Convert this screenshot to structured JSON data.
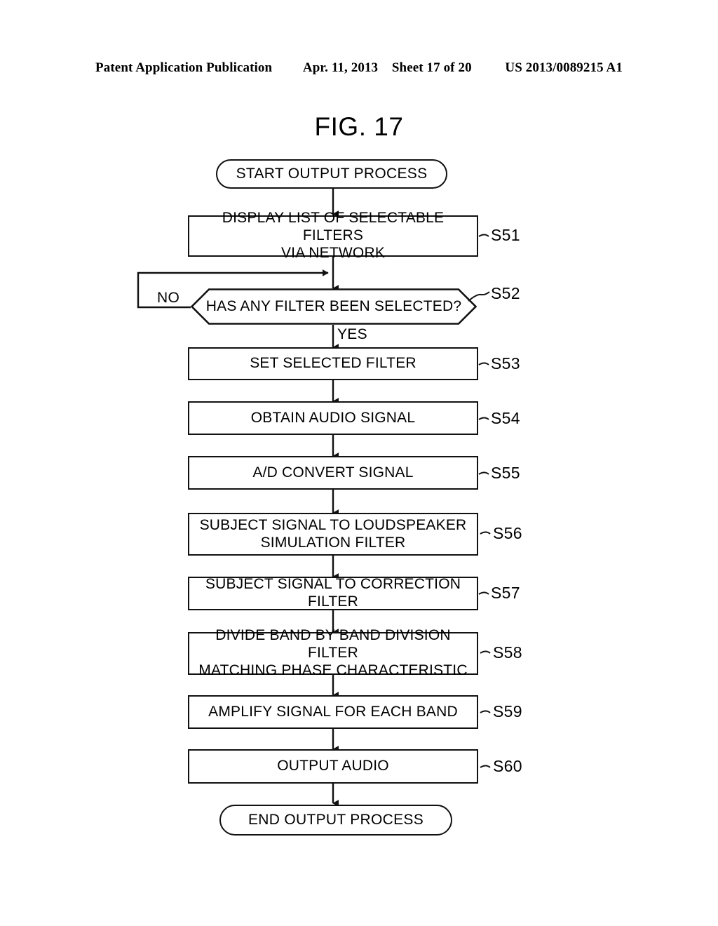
{
  "header": {
    "publication": "Patent Application Publication",
    "date": "Apr. 11, 2013",
    "sheet": "Sheet 17 of 20",
    "patent_number": "US 2013/0089215 A1"
  },
  "figure": {
    "title": "FIG. 17"
  },
  "flowchart": {
    "start": {
      "label": "START OUTPUT PROCESS",
      "shape": "terminator"
    },
    "end": {
      "label": "END OUTPUT PROCESS",
      "shape": "terminator"
    },
    "decision": {
      "label": "HAS ANY FILTER BEEN SELECTED?",
      "step": "S52",
      "shape": "hexagon",
      "yes_label": "YES",
      "no_label": "NO"
    },
    "steps": [
      {
        "step": "S51",
        "line1": "DISPLAY LIST OF SELECTABLE FILTERS",
        "line2": "VIA NETWORK"
      },
      {
        "step": "S53",
        "line1": "SET SELECTED FILTER",
        "line2": ""
      },
      {
        "step": "S54",
        "line1": "OBTAIN AUDIO SIGNAL",
        "line2": ""
      },
      {
        "step": "S55",
        "line1": "A/D CONVERT SIGNAL",
        "line2": ""
      },
      {
        "step": "S56",
        "line1": "SUBJECT SIGNAL TO LOUDSPEAKER",
        "line2": "SIMULATION FILTER"
      },
      {
        "step": "S57",
        "line1": "SUBJECT SIGNAL TO CORRECTION FILTER",
        "line2": ""
      },
      {
        "step": "S58",
        "line1": "DIVIDE BAND BY BAND DIVISION FILTER",
        "line2": "MATCHING PHASE CHARACTERISTIC"
      },
      {
        "step": "S59",
        "line1": "AMPLIFY SIGNAL FOR EACH BAND",
        "line2": ""
      },
      {
        "step": "S60",
        "line1": "OUTPUT AUDIO",
        "line2": ""
      }
    ]
  },
  "colors": {
    "ink": "#111111",
    "paper": "#ffffff"
  }
}
